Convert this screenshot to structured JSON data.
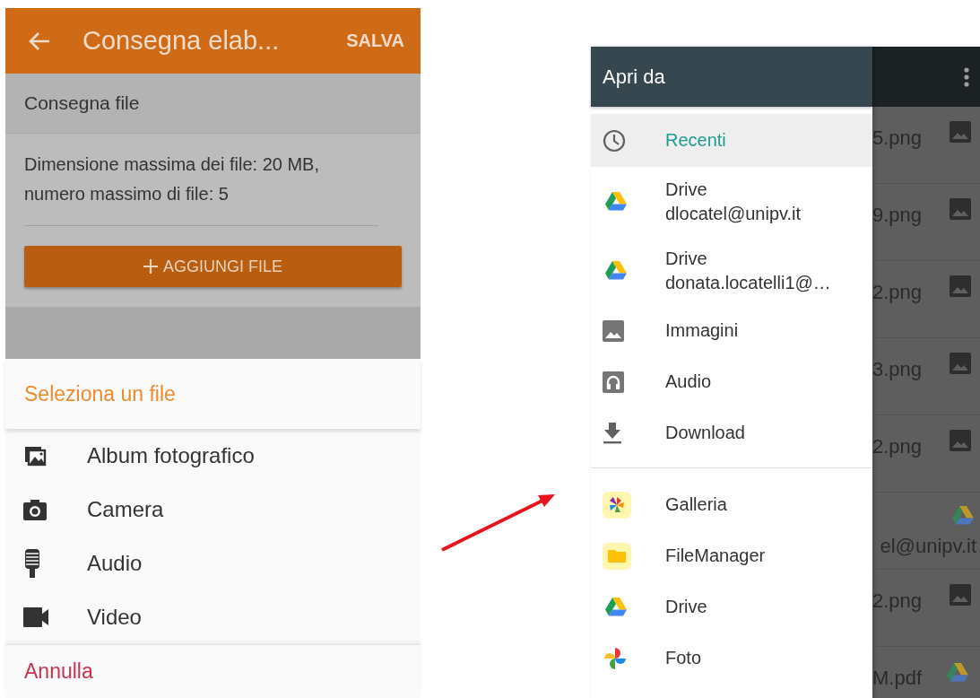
{
  "left_screen": {
    "app_bar": {
      "title": "Consegna elab...",
      "action": "SALVA"
    },
    "section_title": "Consegna file",
    "info": "Dimensione massima dei file: 20 MB, numero massimo di file: 5",
    "add_button": "AGGIUNGI FILE",
    "sheet": {
      "title": "Seleziona un file",
      "options": [
        {
          "kind": "album",
          "label": "Album fotografico"
        },
        {
          "kind": "camera",
          "label": "Camera"
        },
        {
          "kind": "microphone",
          "label": "Audio"
        },
        {
          "kind": "video",
          "label": "Video"
        }
      ],
      "cancel": "Annulla"
    }
  },
  "right_screen": {
    "drawer": {
      "title": "Apri da",
      "roots": [
        {
          "kind": "recent",
          "label": "Recenti",
          "selected": true
        },
        {
          "kind": "drive",
          "label": "Drive",
          "account": "dlocatel@unipv.it",
          "selected": false
        },
        {
          "kind": "drive",
          "label": "Drive",
          "account": "donata.locatelli1@…",
          "selected": false
        },
        {
          "kind": "images",
          "label": "Immagini",
          "selected": false
        },
        {
          "kind": "audio",
          "label": "Audio",
          "selected": false
        },
        {
          "kind": "download",
          "label": "Download",
          "selected": false
        }
      ],
      "apps": [
        {
          "kind": "gallery",
          "label": "Galleria"
        },
        {
          "kind": "folder",
          "label": "FileManager"
        },
        {
          "kind": "drive",
          "label": "Drive"
        },
        {
          "kind": "photos",
          "label": "Foto"
        }
      ]
    },
    "files": [
      {
        "kind": "image",
        "name": "5.png"
      },
      {
        "kind": "image",
        "name": "9.png"
      },
      {
        "kind": "image",
        "name": "2.png"
      },
      {
        "kind": "image",
        "name": "3.png"
      },
      {
        "kind": "image",
        "name": "2.png"
      },
      {
        "kind": "account",
        "name": "el@unipv.it"
      },
      {
        "kind": "image",
        "name": "2.png"
      },
      {
        "kind": "drive",
        "name": "M.pdf"
      }
    ]
  }
}
